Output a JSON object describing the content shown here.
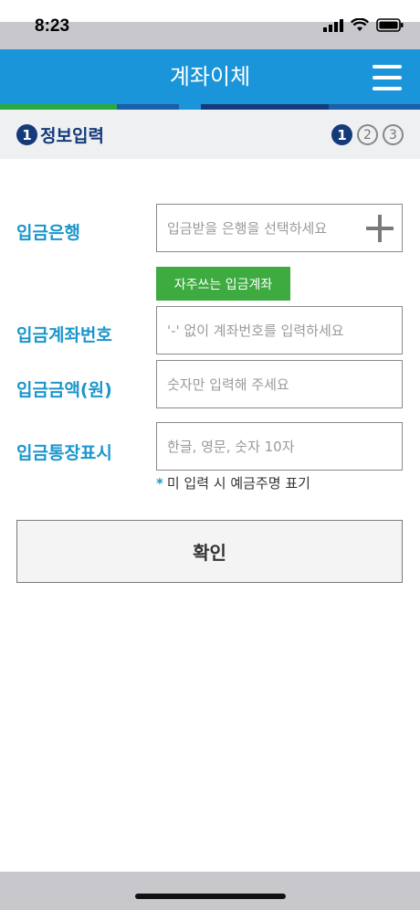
{
  "status": {
    "time": "8:23"
  },
  "header": {
    "title": "계좌이체"
  },
  "color_bar": [
    "#2aa846",
    "#2aa846",
    "#1a5fa8",
    "#1a95d9",
    "#153a7a",
    "#1a5fa8"
  ],
  "step": {
    "current_number": "1",
    "title": "정보입력",
    "steps": [
      "1",
      "2",
      "3"
    ]
  },
  "form": {
    "bank": {
      "label": "입금은행",
      "placeholder": "입금받을 은행을 선택하세요"
    },
    "favorite_button": "자주쓰는 입금계좌",
    "account": {
      "label": "입금계좌번호",
      "placeholder": "'-' 없이 계좌번호를 입력하세요"
    },
    "amount": {
      "label": "입금금액(원)",
      "placeholder": "숫자만 입력해 주세요"
    },
    "memo": {
      "label": "입금통장표시",
      "placeholder": "한글, 영문, 숫자 10자"
    },
    "note_star": "*",
    "note": "미 입력 시 예금주명 표기"
  },
  "confirm_button": "확인"
}
